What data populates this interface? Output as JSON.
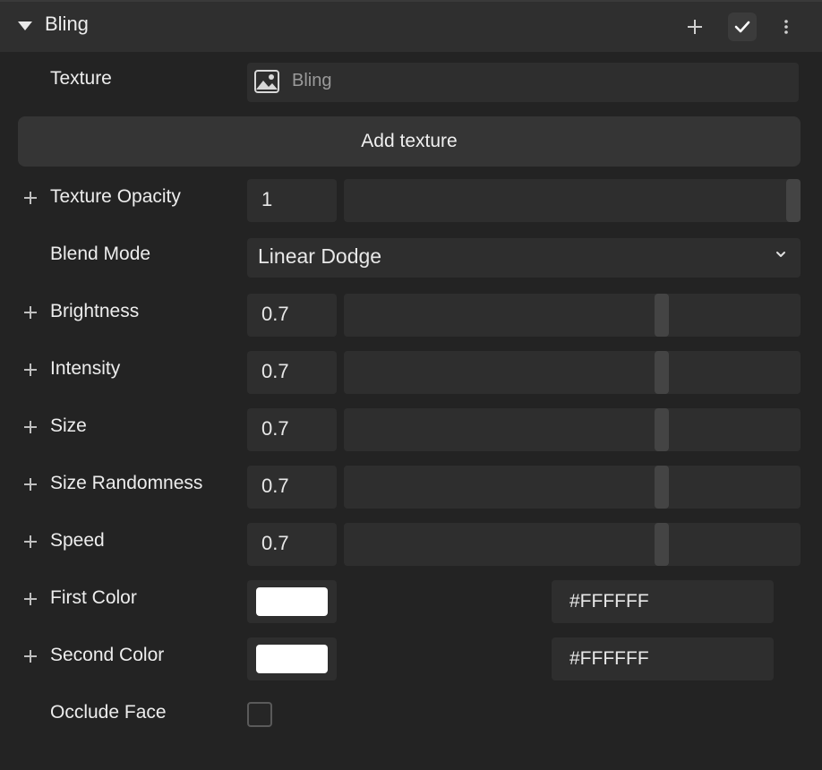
{
  "header": {
    "title": "Bling",
    "collapse_icon": "caret-down-icon",
    "add_icon": "plus-icon",
    "enabled_icon": "check-icon",
    "more_icon": "more-vertical-icon"
  },
  "texture": {
    "label": "Texture",
    "value": "Bling",
    "icon": "image-icon"
  },
  "add_texture_label": "Add texture",
  "texture_opacity": {
    "label": "Texture Opacity",
    "value": "1",
    "level": 1.0
  },
  "blend_mode": {
    "label": "Blend Mode",
    "value": "Linear Dodge",
    "icon": "chevron-down-icon"
  },
  "sliders": [
    {
      "label": "Brightness",
      "value": "0.7",
      "level": 0.7
    },
    {
      "label": "Intensity",
      "value": "0.7",
      "level": 0.7
    },
    {
      "label": "Size",
      "value": "0.7",
      "level": 0.7
    },
    {
      "label": "Size Randomness",
      "value": "0.7",
      "level": 0.7
    },
    {
      "label": "Speed",
      "value": "0.7",
      "level": 0.7
    }
  ],
  "first_color": {
    "label": "First Color",
    "hex": "#FFFFFF"
  },
  "second_color": {
    "label": "Second Color",
    "hex": "#FFFFFF"
  },
  "occlude_face": {
    "label": "Occlude Face",
    "checked": false
  },
  "colors": {
    "panel_bg": "#232323",
    "header_bg": "#2f2f2f",
    "field_bg": "#2e2e2e",
    "thumb": "#444444"
  }
}
